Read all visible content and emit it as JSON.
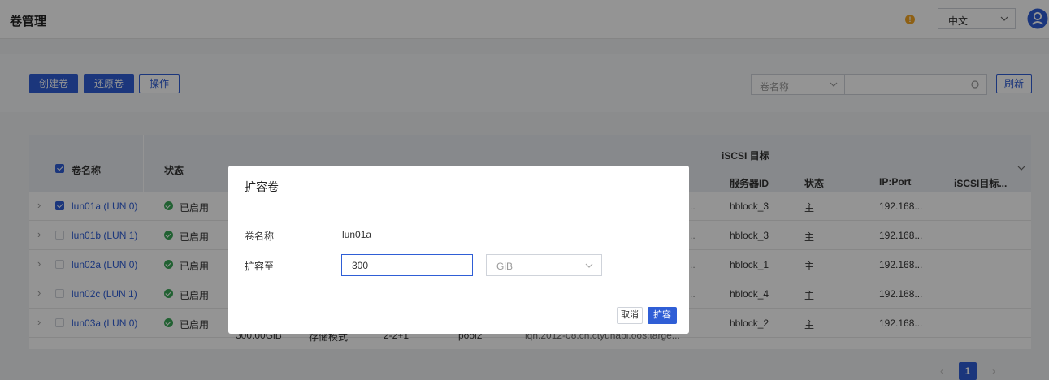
{
  "header": {
    "title": "卷管理",
    "language": "中文",
    "alert_icon": "alert-icon",
    "user_icon": "user-avatar-icon"
  },
  "toolbar": {
    "create_label": "创建卷",
    "restore_label": "还原卷",
    "actions_label": "操作",
    "search_field": "卷名称",
    "search_value": "",
    "refresh_label": "刷新"
  },
  "table": {
    "headers": {
      "name": "卷名称",
      "status": "状态",
      "iscsi_group": "iSCSI 目标",
      "server_id": "服务器ID",
      "iscsi_status": "状态",
      "ip_port": "IP:Port",
      "iscsi_target": "iSCSI目标..."
    },
    "rows": [
      {
        "name": "lun01a (LUN 0)",
        "status": "已启用",
        "trail": "..",
        "server": "hblock_3",
        "role": "主",
        "ip": "192.168...",
        "checked": true
      },
      {
        "name": "lun01b (LUN 1)",
        "status": "已启用",
        "trail": "..",
        "server": "hblock_3",
        "role": "主",
        "ip": "192.168...",
        "checked": false
      },
      {
        "name": "lun02a (LUN 0)",
        "status": "已启用",
        "trail": "..",
        "server": "hblock_1",
        "role": "主",
        "ip": "192.168...",
        "checked": false
      },
      {
        "name": "lun02c (LUN 1)",
        "status": "已启用",
        "trail": "..",
        "server": "hblock_4",
        "role": "主",
        "ip": "192.168...",
        "checked": false
      },
      {
        "name": "lun03a (LUN 0)",
        "status": "已启用",
        "trail": "iqn.2012-08.cn.ctyunapi.oos:targe...",
        "server": "hblock_2",
        "role": "主",
        "ip": "192.168...",
        "checked": false
      }
    ],
    "row5_partial": {
      "capacity": "300.00GiB",
      "mode": "存储模式",
      "redundancy": "2-2+1",
      "pool": "pool2"
    }
  },
  "pagination": {
    "current": "1"
  },
  "modal": {
    "title": "扩容卷",
    "name_label": "卷名称",
    "name_value": "lun01a",
    "expand_label": "扩容至",
    "expand_value": "300",
    "unit": "GiB",
    "cancel_label": "取消",
    "confirm_label": "扩容"
  },
  "colors": {
    "accent": "#2f5ed6",
    "success": "#3aa757",
    "warning": "#f5a623"
  }
}
